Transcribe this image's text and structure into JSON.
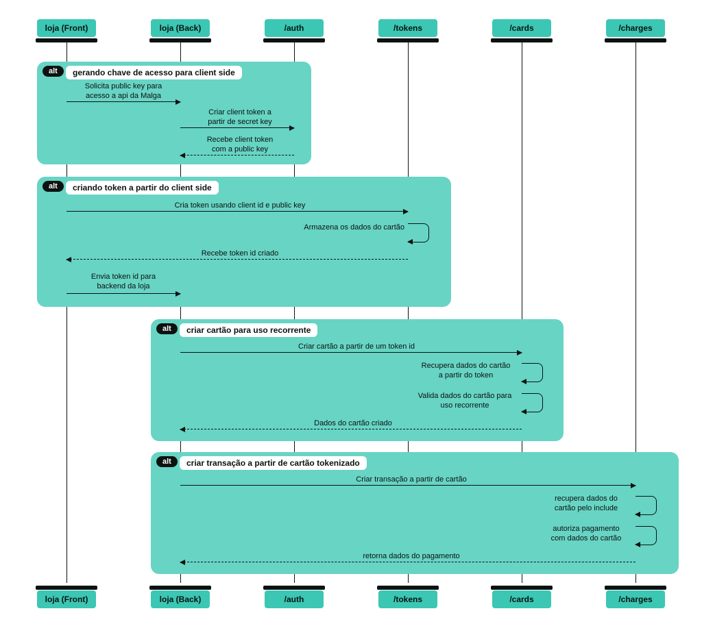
{
  "actors": {
    "front": "loja (Front)",
    "back": "loja (Back)",
    "auth": "/auth",
    "tokens": "/tokens",
    "cards": "/cards",
    "charges": "/charges"
  },
  "alt_word": "alt",
  "regions": {
    "r1_title": "gerando chave de acesso para client side",
    "r2_title": "criando token a partir do client side",
    "r3_title": "criar cartão para uso recorrente",
    "r4_title": "criar transação a partir de cartão tokenizado"
  },
  "messages": {
    "m1": "Solicita public key para\nacesso a api da Malga",
    "m2": "Criar client token a\npartir de secret key",
    "m3": "Recebe client token\ncom a public key",
    "m4": "Cria token usando client id e public key",
    "m5": "Armazena os dados do cartão",
    "m6": "Recebe token id criado",
    "m7": "Envia token id para\nbackend da loja",
    "m8": "Criar cartão a partir de um token id",
    "m9": "Recupera dados do cartão\na partir do token",
    "m10": "Valida dados do cartão para\nuso recorrente",
    "m11": "Dados do cartão criado",
    "m12": "Criar transação a partir de cartão",
    "m13": "recupera dados do\ncartão pelo include",
    "m14": "autoriza pagamento\ncom dados do cartão",
    "m15": "retorna dados do pagamento"
  },
  "colors": {
    "teal": "#3BC7B3",
    "teal_light": "#67D4C4",
    "ink": "#0b1210"
  }
}
